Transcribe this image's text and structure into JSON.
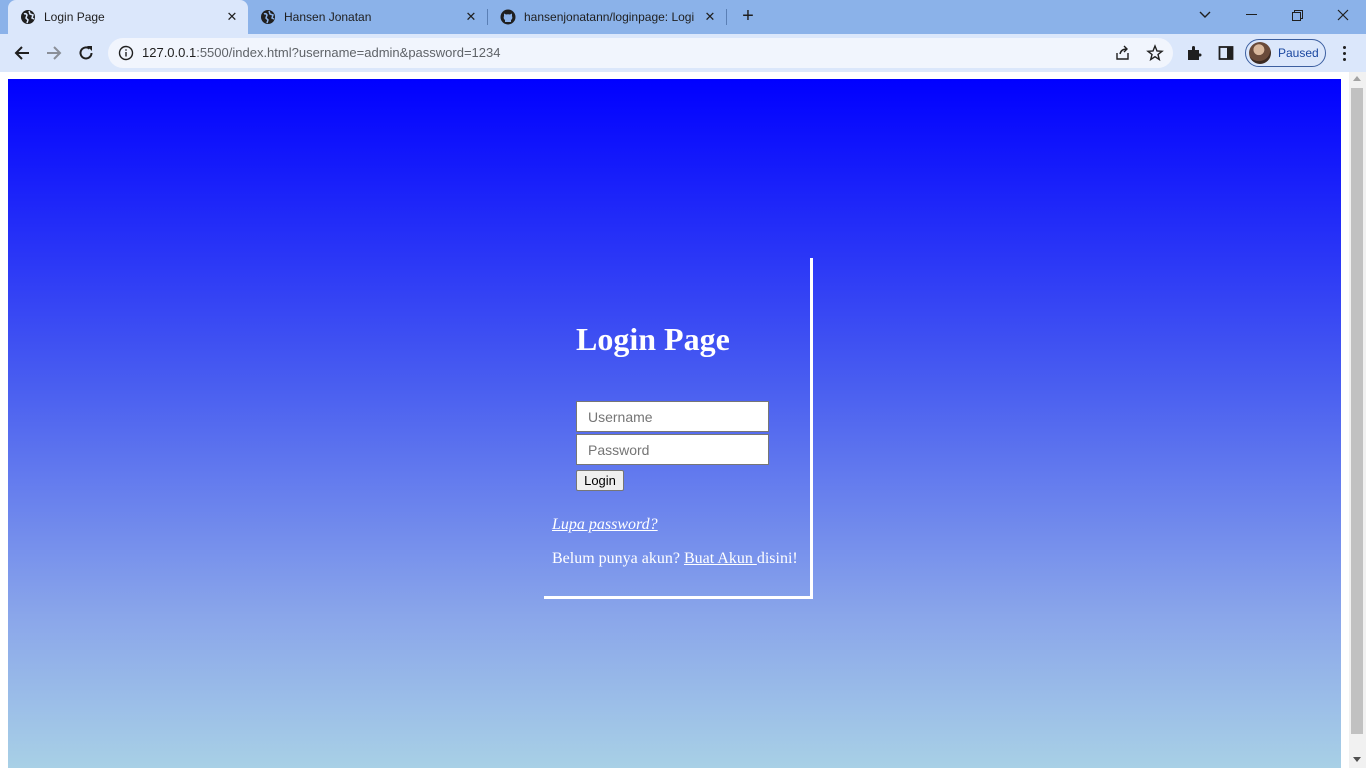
{
  "browser": {
    "tabs": [
      {
        "title": "Login Page",
        "active": true,
        "icon": "globe-icon"
      },
      {
        "title": "Hansen Jonatan",
        "active": false,
        "icon": "globe-icon"
      },
      {
        "title": "hansenjonatann/loginpage: Logi",
        "active": false,
        "icon": "github-icon"
      }
    ],
    "url_host": "127.0.0.1",
    "url_rest": ":5500/index.html?username=admin&password=1234",
    "profile_status": "Paused",
    "colors": {
      "tabstrip": "#8bb2e9",
      "toolbar": "#dbe7fb"
    }
  },
  "page": {
    "title": "Login Page",
    "username_placeholder": "Username",
    "password_placeholder": "Password",
    "login_button": "Login",
    "forgot_password_link": "Lupa password?",
    "signup_prefix": "Belum punya akun? ",
    "signup_link": "Buat Akun ",
    "signup_suffix": "disini!",
    "colors": {
      "gradient_top": "#0000ff",
      "gradient_bottom": "#a8d0e6",
      "text": "#ffffff"
    }
  }
}
